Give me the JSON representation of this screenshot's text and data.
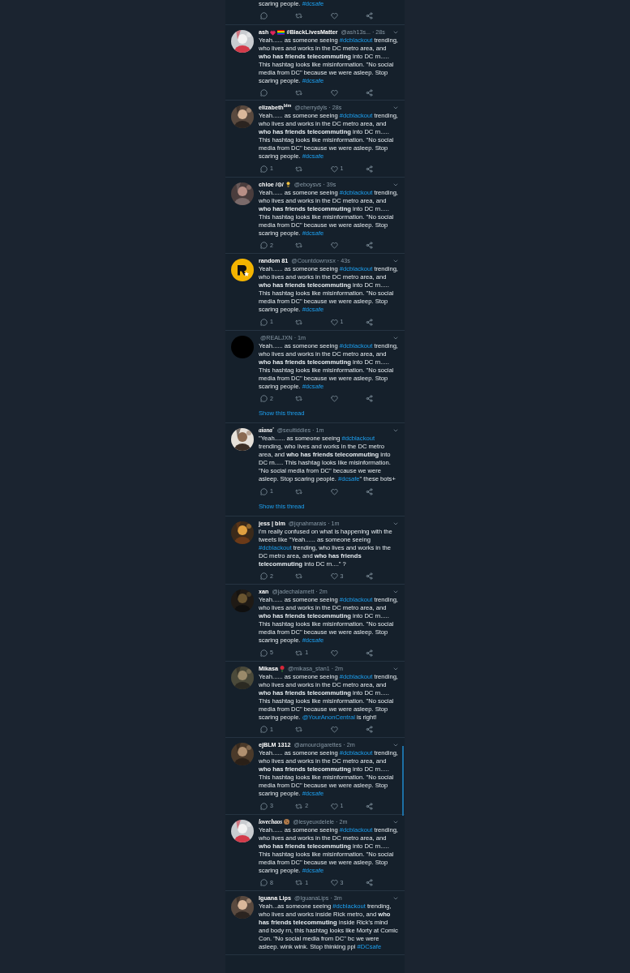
{
  "top_fragment": {
    "text": [
      {
        "kind": "plain",
        "text": "scaring people. "
      },
      {
        "kind": "link",
        "text": "#dcsafe"
      }
    ],
    "actions_shown": true
  },
  "tweets": [
    {
      "avatar": {
        "kind": "picture"
      },
      "name_parts": [
        {
          "kind": "text",
          "text": "ash"
        },
        {
          "kind": "heart"
        },
        {
          "kind": "flag"
        },
        {
          "kind": "text",
          "text": "#BlackLivesMatter"
        }
      ],
      "handle": "@ash13s...",
      "time": "· 28s",
      "text": [
        {
          "kind": "plain",
          "text": "Yeah...... as someone seeing "
        },
        {
          "kind": "link",
          "text": "#dcblackout"
        },
        {
          "kind": "plain",
          "text": " trending, who lives and works in the DC metro area, and **who has friends telecommuting** into DC rn..... This hashtag looks like misinformation. \"No social media from DC\" because we were asleep. Stop scaring people. "
        },
        {
          "kind": "link",
          "text": "#dcsafe"
        }
      ],
      "actions_shown": true,
      "show_thread": false
    },
    {
      "avatar": {
        "kind": "picture"
      },
      "name_parts": [
        {
          "kind": "text",
          "text": "elizabeth$^{blm}$"
        }
      ],
      "handle": "@cherrydyls",
      "time": "· 28s",
      "text": [
        {
          "kind": "plain",
          "text": "Yeah...... as someone seeing "
        },
        {
          "kind": "link",
          "text": "#dcblackout"
        },
        {
          "kind": "plain",
          "text": " trending, who lives and works in the DC metro area, and **who has friends telecommuting** into DC rn..... This hashtag looks like misinformation. \"No social media from DC\" because we were asleep. Stop scaring people. "
        },
        {
          "kind": "link",
          "text": "#dcsafe"
        }
      ],
      "actions_shown": true,
      "replies": "1",
      "likes": "1",
      "show_thread": false
    },
    {
      "avatar": {
        "kind": "picture"
      },
      "name_parts": [
        {
          "kind": "text",
          "text": "chloe /⊙/"
        },
        {
          "kind": "bulb"
        }
      ],
      "handle": "@eboysvs",
      "time": "· 39s",
      "text": [
        {
          "kind": "plain",
          "text": "Yeah...... as someone seeing "
        },
        {
          "kind": "link",
          "text": "#dcblackout"
        },
        {
          "kind": "plain",
          "text": " trending, who lives and works in the DC metro area, and **who has friends telecommuting** into DC rn..... This hashtag looks like misinformation. \"No social media from DC\" because we were asleep. Stop scaring people. "
        },
        {
          "kind": "link",
          "text": "#dcsafe"
        }
      ],
      "actions_shown": true,
      "replies": "2",
      "show_thread": false
    },
    {
      "avatar": {
        "kind": "logo"
      },
      "name_parts": [
        {
          "kind": "text",
          "text": "random 81"
        }
      ],
      "handle": "@Countdownxsx",
      "time": "· 43s",
      "text": [
        {
          "kind": "plain",
          "text": "Yeah...... as someone seeing "
        },
        {
          "kind": "link",
          "text": "#dcblackout"
        },
        {
          "kind": "plain",
          "text": " trending, who lives and works in the DC metro area, and **who has friends telecommuting** into DC rn..... This hashtag looks like misinformation. \"No social media from DC\" because we were asleep. Stop scaring people. "
        },
        {
          "kind": "link",
          "text": "#dcsafe"
        }
      ],
      "actions_shown": true,
      "replies": "1",
      "likes": "1",
      "show_thread": false
    },
    {
      "avatar": {
        "kind": "dark"
      },
      "handle": "@REALJXN",
      "time": "· 1m",
      "text": [
        {
          "kind": "plain",
          "text": "Yeah...... as someone seeing "
        },
        {
          "kind": "link",
          "text": "#dcblackout"
        },
        {
          "kind": "plain",
          "text": " trending, who lives and works in the DC metro area, and **who has friends telecommuting** into DC rn..... This hashtag looks like misinformation. \"No social media from DC\" because we were asleep. Stop scaring people. "
        },
        {
          "kind": "link",
          "text": "#dcsafe"
        }
      ],
      "actions_shown": true,
      "replies": "2",
      "show_thread": true,
      "show_thread_label": "Show this thread"
    },
    {
      "avatar": {
        "kind": "picture"
      },
      "name_parts": [
        {
          "kind": "script",
          "text": "aiana'"
        }
      ],
      "handle": "@seultiddies",
      "time": "· 1m",
      "text": [
        {
          "kind": "plain",
          "text": "\"Yeah...... as someone seeing "
        },
        {
          "kind": "link",
          "text": "#dcblackout"
        },
        {
          "kind": "plain",
          "text": " trending, who lives and works in the DC metro area, and **who has friends telecommuting** into DC rn..... This hashtag looks like misinformation. \"No social media from DC\" because we were asleep. Stop scaring people. "
        },
        {
          "kind": "link",
          "text": "#dcsafe"
        },
        {
          "kind": "plain",
          "text": "\" these bots+"
        }
      ],
      "actions_shown": true,
      "replies": "1",
      "show_thread": true,
      "show_thread_label": "Show this thread"
    },
    {
      "avatar": {
        "kind": "picture"
      },
      "name_parts": [
        {
          "kind": "text",
          "text": "jess | blm"
        }
      ],
      "handle": "@jqnahmarais",
      "time": "· 1m",
      "text": [
        {
          "kind": "plain",
          "text": "i'm really confused on what  is happening with the tweets like \"Yeah...... as someone seeing "
        },
        {
          "kind": "link",
          "text": "#dcblackout"
        },
        {
          "kind": "plain",
          "text": " trending, who lives and works in the DC metro area, and **who has friends telecommuting** into DC rn....\" ?"
        }
      ],
      "actions_shown": true,
      "replies": "2",
      "likes": "3",
      "show_thread": false
    },
    {
      "avatar": {
        "kind": "picture"
      },
      "name_parts": [
        {
          "kind": "text",
          "text": "xan"
        }
      ],
      "handle": "@jadechalamett",
      "time": "· 2m",
      "text": [
        {
          "kind": "plain",
          "text": "Yeah...... as someone seeing "
        },
        {
          "kind": "link",
          "text": "#dcblackout"
        },
        {
          "kind": "plain",
          "text": " trending, who lives and works in the DC metro area, and **who has friends telecommuting** into DC rn..... This hashtag looks like misinformation. \"No social media from DC\" because we were asleep. Stop scaring people. "
        },
        {
          "kind": "link",
          "text": "#dcsafe"
        }
      ],
      "actions_shown": true,
      "replies": "5",
      "retweets": "1",
      "show_thread": false
    },
    {
      "avatar": {
        "kind": "picture"
      },
      "name_parts": [
        {
          "kind": "text",
          "text": "Mikasa"
        },
        {
          "kind": "rose"
        }
      ],
      "handle": "@mikasa_stan1",
      "time": "· 2m",
      "text": [
        {
          "kind": "plain",
          "text": "Yeah...... as someone seeing "
        },
        {
          "kind": "link",
          "text": "#dcblackout"
        },
        {
          "kind": "plain",
          "text": " trending, who lives and works in the DC metro area, and **who has friends telecommuting** into DC rn..... This hashtag looks like misinformation. \"No social media from DC\" because we were asleep. Stop scaring people. "
        },
        {
          "kind": "link",
          "text": "@YourAnonCentral"
        },
        {
          "kind": "plain",
          "text": " is right!"
        }
      ],
      "actions_shown": true,
      "replies": "1",
      "show_thread": false
    },
    {
      "avatar": {
        "kind": "picture"
      },
      "name_parts": [
        {
          "kind": "text",
          "text": "ejBLM 1312"
        }
      ],
      "handle": "@amourcigarettes",
      "time": "· 2m",
      "text": [
        {
          "kind": "plain",
          "text": "Yeah...... as someone seeing "
        },
        {
          "kind": "link",
          "text": "#dcblackout"
        },
        {
          "kind": "plain",
          "text": " trending, who lives and works in the DC metro area, and **who has friends telecommuting** into DC rn..... This hashtag looks like misinformation. \"No social media from DC\" because we were asleep. Stop scaring people. "
        },
        {
          "kind": "link",
          "text": "#dcsafe"
        }
      ],
      "actions_shown": true,
      "replies": "3",
      "retweets": "2",
      "likes": "1",
      "show_thread": false
    },
    {
      "avatar": {
        "kind": "picture"
      },
      "name_parts": [
        {
          "kind": "script",
          "text": "lovechaos"
        },
        {
          "kind": "cookie"
        }
      ],
      "handle": "@lesyeuxdelele",
      "time": "· 2m",
      "text": [
        {
          "kind": "plain",
          "text": "Yeah...... as someone seeing "
        },
        {
          "kind": "link",
          "text": "#dcblackout"
        },
        {
          "kind": "plain",
          "text": " trending, who lives and works in the DC metro area, and **who has friends telecommuting** into DC rn..... This hashtag looks like misinformation. \"No social media from DC\" because we were asleep. Stop scaring people. "
        },
        {
          "kind": "link",
          "text": "#dcsafe"
        }
      ],
      "actions_shown": true,
      "replies": "8",
      "retweets": "1",
      "likes": "3",
      "show_thread": false
    },
    {
      "avatar": {
        "kind": "picture"
      },
      "name_parts": [
        {
          "kind": "text",
          "text": "Iguana Lips"
        }
      ],
      "handle": "@IguanaLips",
      "time": "· 3m",
      "text": [
        {
          "kind": "plain",
          "text": "Yeah...as someone seeing "
        },
        {
          "kind": "link",
          "text": "#dcblackout"
        },
        {
          "kind": "plain",
          "text": " trending, who lives and works inside Rick metro, and **who has friends telecommuting** inside Rick's mind and body rn, this hashtag looks like Morty at Comic Con. \"No social media from DC\" bc we were asleep. wink wink. Stop thinking ppl "
        },
        {
          "kind": "link",
          "text": "#DCsafe"
        }
      ],
      "actions_shown": false,
      "show_thread": false
    }
  ]
}
